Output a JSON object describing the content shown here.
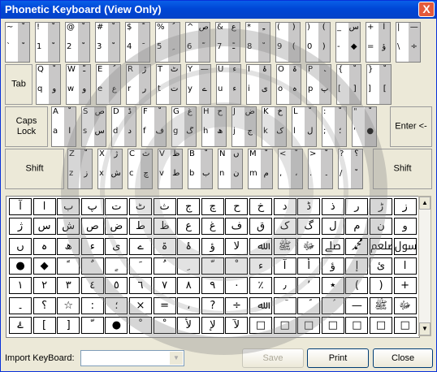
{
  "window": {
    "title": "Phonetic Keyboard (View Only)",
    "close_glyph": "X"
  },
  "keyboard": {
    "rows": [
      [
        {
          "tl": "~",
          "tr": "ﹾ",
          "bl": "`",
          "br": "ﹾ"
        },
        {
          "tl": "!",
          "tr": "ﹾ",
          "bl": "1",
          "br": "ﹾ"
        },
        {
          "tl": "@",
          "tr": "ﹾ",
          "bl": "2",
          "br": "ﹾ"
        },
        {
          "tl": "#",
          "tr": "ﹾ",
          "bl": "3",
          "br": "ﹾ"
        },
        {
          "tl": "$",
          "tr": "ﹰ",
          "bl": "4",
          "br": "ﹶ"
        },
        {
          "tl": "%",
          "tr": "ﹸ",
          "bl": "5",
          "br": "ﹺ"
        },
        {
          "tl": "^",
          "tr": "ص",
          "bl": "6",
          "br": "ﹼ"
        },
        {
          "tl": "&",
          "tr": "ع",
          "bl": "7",
          "br": "ﹱ"
        },
        {
          "tl": "*",
          "tr": "ﹻ",
          "bl": "8",
          "br": "ﹾ"
        },
        {
          "tl": "(",
          "tr": ")",
          "bl": "9",
          "br": "("
        },
        {
          "tl": ")",
          "tr": "(",
          "bl": "0",
          "br": ")"
        },
        {
          "tl": "_",
          "tr": "س",
          "bl": "-",
          "br": "◆"
        },
        {
          "tl": "+",
          "tr": "آ",
          "bl": "=",
          "br": "ؤ"
        },
        {
          "tl": "|",
          "tr": "—",
          "bl": "\\",
          "br": "÷"
        }
      ],
      [
        {
          "tl": "Q",
          "tr": "ﹾ",
          "bl": "q",
          "br": "و"
        },
        {
          "tl": "W",
          "tr": "ﹽ",
          "bl": "w",
          "br": "و"
        },
        {
          "tl": "E",
          "tr": "ﹸ",
          "bl": "e",
          "br": "ع"
        },
        {
          "tl": "R",
          "tr": "ڑ",
          "bl": "r",
          "br": "ر"
        },
        {
          "tl": "T",
          "tr": "ٹ",
          "bl": "t",
          "br": "ت"
        },
        {
          "tl": "Y",
          "tr": "—",
          "bl": "y",
          "br": "ے"
        },
        {
          "tl": "U",
          "tr": "ء",
          "bl": "u",
          "br": "ء"
        },
        {
          "tl": "I",
          "tr": "ۂ",
          "bl": "i",
          "br": "ی"
        },
        {
          "tl": "O",
          "tr": "ۃ",
          "bl": "o",
          "br": "ہ"
        },
        {
          "tl": "P",
          "tr": "ﹳ",
          "bl": "p",
          "br": "پ"
        },
        {
          "tl": "{",
          "tr": "ﹾ",
          "bl": "[",
          "br": "]"
        },
        {
          "tl": "}",
          "tr": "ﹾ",
          "bl": "]",
          "br": "["
        }
      ],
      [
        {
          "tl": "A",
          "tr": "ﹾ",
          "bl": "a",
          "br": "ا"
        },
        {
          "tl": "S",
          "tr": "ص",
          "bl": "s",
          "br": "س"
        },
        {
          "tl": "D",
          "tr": "ڈ",
          "bl": "d",
          "br": "د"
        },
        {
          "tl": "F",
          "tr": "ﹾ",
          "bl": "f",
          "br": "ف"
        },
        {
          "tl": "G",
          "tr": "غ",
          "bl": "g",
          "br": "گ"
        },
        {
          "tl": "H",
          "tr": "ح",
          "bl": "h",
          "br": "ھ"
        },
        {
          "tl": "J",
          "tr": "ض",
          "bl": "j",
          "br": "ج"
        },
        {
          "tl": "K",
          "tr": "خ",
          "bl": "k",
          "br": "ک"
        },
        {
          "tl": "L",
          "tr": "ﹾ",
          "bl": "l",
          "br": "ل"
        },
        {
          "tl": ":",
          "tr": "ﹾ",
          "bl": ";",
          "br": "؛"
        },
        {
          "tl": "\"",
          "tr": "ﹾ",
          "bl": "'",
          "br": "●"
        }
      ],
      [
        {
          "tl": "Z",
          "tr": "ﹾ",
          "bl": "z",
          "br": "ز"
        },
        {
          "tl": "X",
          "tr": "ژ",
          "bl": "x",
          "br": "ش"
        },
        {
          "tl": "C",
          "tr": "ث",
          "bl": "c",
          "br": "چ"
        },
        {
          "tl": "V",
          "tr": "ظ",
          "bl": "v",
          "br": "ط"
        },
        {
          "tl": "B",
          "tr": "ﹾ",
          "bl": "b",
          "br": "ب"
        },
        {
          "tl": "N",
          "tr": "ں",
          "bl": "n",
          "br": "ن"
        },
        {
          "tl": "M",
          "tr": "ﹾ",
          "bl": "m",
          "br": "م"
        },
        {
          "tl": "<",
          "tr": "ﹾ",
          "bl": ",",
          "br": "،"
        },
        {
          "tl": ">",
          "tr": "ﹾ",
          "bl": ".",
          "br": "۔"
        },
        {
          "tl": "?",
          "tr": "؟",
          "bl": "/",
          "br": "ﹾ"
        }
      ]
    ],
    "specials": {
      "tab": "Tab",
      "caps_line1": "Caps",
      "caps_line2": "Lock",
      "enter": "Enter <-",
      "shift_left": "Shift",
      "shift_right": "Shift"
    }
  },
  "char_grid": [
    [
      "آ",
      "ا",
      "ب",
      "پ",
      "ت",
      "ٹ",
      "ث",
      "ج",
      "چ",
      "ح",
      "خ",
      "د",
      "ڈ",
      "ذ",
      "ر",
      "ڑ",
      "ز"
    ],
    [
      "ژ",
      "س",
      "ش",
      "ص",
      "ض",
      "ط",
      "ظ",
      "ع",
      "غ",
      "ف",
      "ق",
      "ک",
      "گ",
      "ل",
      "م",
      "ن",
      "و"
    ],
    [
      "ں",
      "ہ",
      "ھ",
      "ء",
      "ی",
      "ے",
      "ۃ",
      "ۂ",
      "ؤ",
      "ﻻ",
      "ﷲ",
      "ﷺ",
      "ﷻ",
      "ﷰ",
      "ﷴ",
      "ﷵ",
      "ﷶ"
    ],
    [
      "●",
      "◆",
      "ﹰ",
      "ﹲ",
      "ﹴ",
      "ﹶ",
      "ﹸ",
      "ﹺ",
      "ﹼ",
      "ﹾ",
      "ﺀ",
      "ﺁ",
      "ﺃ",
      "ﺅ",
      "ﺇ",
      "ﺉ",
      "ﺍ"
    ],
    [
      "١",
      "٢",
      "٣",
      "٤",
      "٥",
      "٦",
      "٧",
      "٨",
      "٩",
      "٠",
      "٪",
      "٫",
      "٬",
      "٭",
      "(",
      ")",
      "+"
    ],
    [
      "۔",
      "؟",
      "☆",
      ":",
      "؛",
      "×",
      "=",
      "،",
      "?",
      "÷",
      "ﷲ",
      "ؔ",
      "ؐ",
      "ؑ",
      "—",
      "ﷺ",
      "ﷻ"
    ],
    [
      "ۓ",
      "[",
      "]",
      "ﹼ",
      "●",
      "ﹾ",
      "ﹾ",
      "ﻷ",
      "ﻹ",
      "ﻵ",
      "□",
      "□",
      "□",
      "□",
      "□",
      "□",
      "□"
    ]
  ],
  "bottom": {
    "import_label": "Import KeyBoard:",
    "combo_arrow": "▼",
    "save": "Save",
    "print": "Print",
    "close": "Close"
  }
}
